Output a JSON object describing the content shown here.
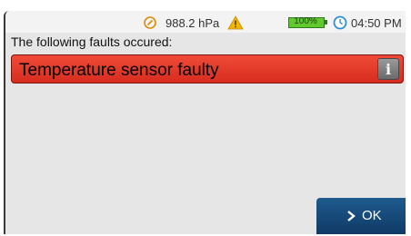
{
  "status_bar": {
    "pressure_icon": "gauge-icon",
    "pressure": "988.2 hPa",
    "warning_icon": "warning-triangle-icon",
    "battery_icon": "battery-icon",
    "battery": "100%",
    "clock_icon": "clock-icon",
    "time": "04:50 PM"
  },
  "fault_panel": {
    "heading": "The following faults occured:",
    "faults": [
      {
        "text": "Temperature sensor faulty",
        "info_icon": "info-icon",
        "info_glyph": "i"
      }
    ]
  },
  "footer": {
    "ok_icon": "chevron-right-icon",
    "ok_label": "OK"
  },
  "colors": {
    "fault_background": "#e23a2a",
    "ok_button": "#174a7a",
    "battery_fill": "#5fc92e",
    "warning": "#f2b600",
    "clock": "#2b8fd6",
    "gauge": "#e08a00",
    "screen_background": "#e6e6e6"
  }
}
